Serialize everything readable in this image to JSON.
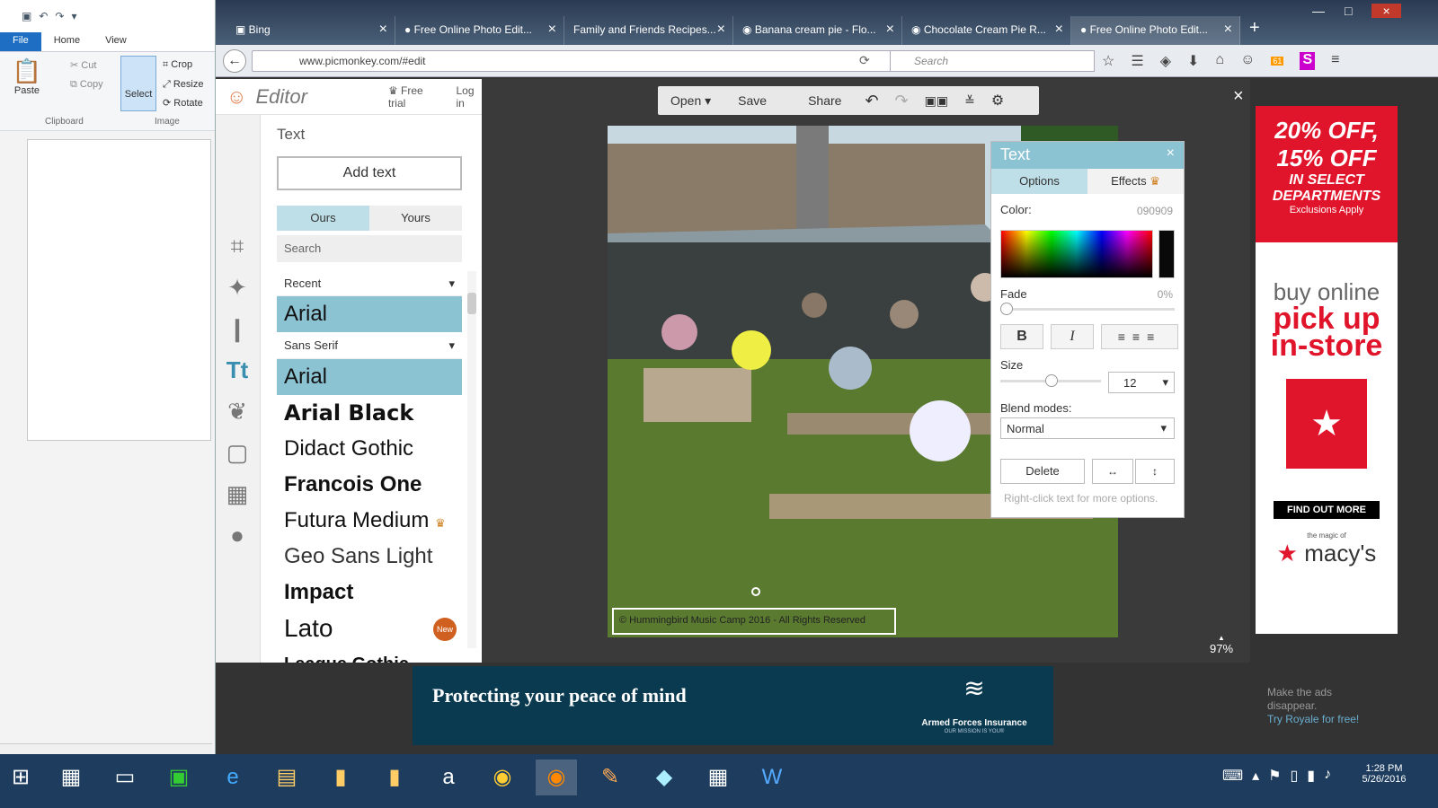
{
  "paint": {
    "tabs": [
      "File",
      "Home",
      "View"
    ],
    "clipboard": {
      "paste": "Paste",
      "cut": "Cut",
      "copy": "Copy",
      "group": "Clipboard"
    },
    "image": {
      "select": "Select",
      "crop": "Crop",
      "resize": "Resize",
      "rotate": "Rotate",
      "group": "Image"
    }
  },
  "browser": {
    "tabs": [
      {
        "label": "Bing"
      },
      {
        "label": "Free Online Photo Edit..."
      },
      {
        "label": "Family and Friends Recipes..."
      },
      {
        "label": "Banana cream pie - Flo..."
      },
      {
        "label": "Chocolate Cream Pie R..."
      },
      {
        "label": "Free Online Photo Edit..."
      }
    ],
    "url": "www.picmonkey.com/#edit",
    "search_placeholder": "Search",
    "badge_count": "61"
  },
  "editor": {
    "logo": "Editor",
    "free_trial": "Free trial",
    "login": "Log in",
    "panel_title": "Text",
    "add_text": "Add text",
    "tab_ours": "Ours",
    "tab_yours": "Yours",
    "search_placeholder": "Search",
    "recent": "Recent",
    "sans_serif": "Sans Serif",
    "fonts": [
      "Arial",
      "Arial Black",
      "Didact Gothic",
      "Francois One",
      "Futura Medium",
      "Geo Sans Light",
      "Impact",
      "Lato",
      "League Gothic"
    ],
    "recent_font": "Arial",
    "new_badge": "New",
    "toolbar": {
      "open": "Open",
      "save": "Save",
      "share": "Share"
    },
    "zoom": "97%",
    "watermark": "© Hummingbird Music Camp 2016 - All Rights Reserved"
  },
  "text_panel": {
    "title": "Text",
    "tab_options": "Options",
    "tab_effects": "Effects",
    "color_label": "Color:",
    "color_value": "090909",
    "fade_label": "Fade",
    "fade_value": "0%",
    "size_label": "Size",
    "size_value": "12",
    "blend_label": "Blend modes:",
    "blend_value": "Normal",
    "delete": "Delete",
    "hint": "Right-click text for more options."
  },
  "ads": {
    "right_line1": "20% OFF,",
    "right_line2": "15% OFF",
    "right_line3": "IN SELECT DEPARTMENTS",
    "right_line4": "Exclusions Apply",
    "right_buy1": "buy online",
    "right_buy2": "pick up",
    "right_buy3": "in-store",
    "right_cta": "FIND OUT MORE",
    "right_tagline": "the magic of",
    "right_brand": "macy's",
    "bottom_headline": "Protecting your peace of mind",
    "bottom_brand": "Armed Forces Insurance",
    "bottom_slogan": "OUR MISSION IS YOU®",
    "disappear1": "Make the ads",
    "disappear2": "disappear.",
    "disappear3": "Try Royale for free!"
  },
  "taskbar": {
    "time": "1:28 PM",
    "date": "5/26/2016"
  }
}
